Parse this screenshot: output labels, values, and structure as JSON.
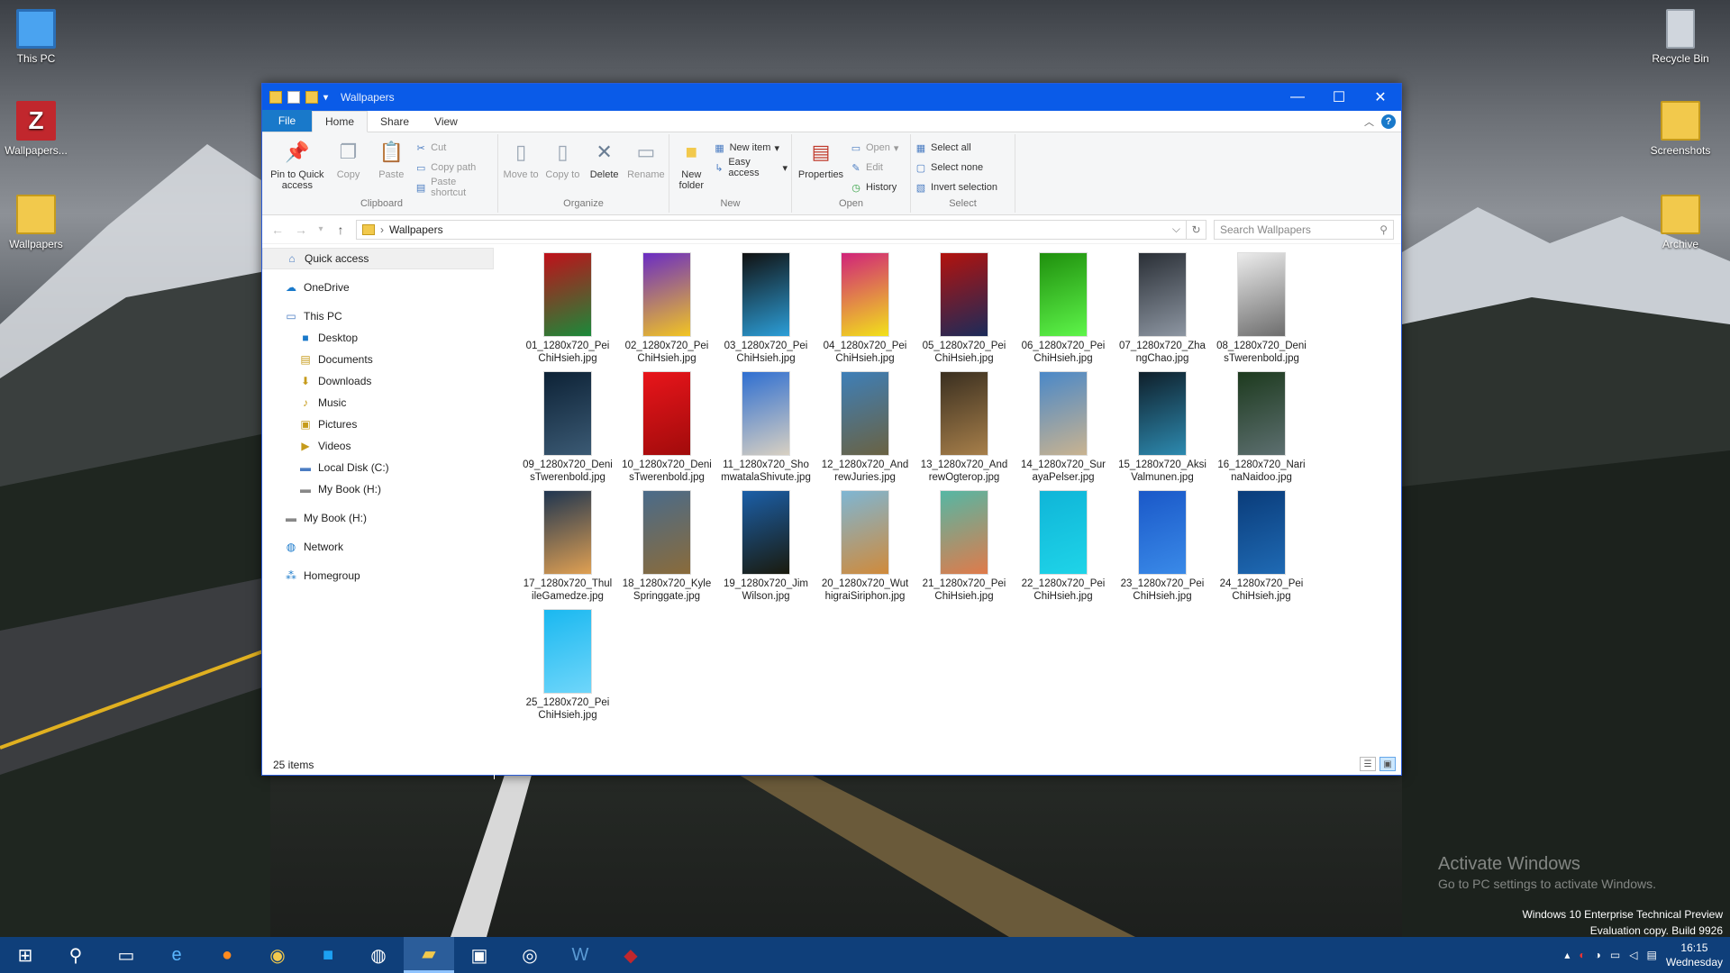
{
  "desktop": {
    "icons_left": [
      {
        "label": "This PC",
        "icon": "pc-icon",
        "color": "#4aa3f0"
      },
      {
        "label": "Wallpapers...",
        "icon": "zotero-icon",
        "color": "#c1272d"
      },
      {
        "label": "Wallpapers",
        "icon": "folder-icon",
        "color": "#f2c94c"
      }
    ],
    "icons_right": [
      {
        "label": "Recycle Bin",
        "icon": "recycle-bin-icon",
        "color": "#d0d6dd"
      },
      {
        "label": "Screenshots",
        "icon": "folder-icon",
        "color": "#f2c94c"
      },
      {
        "label": "Archive",
        "icon": "folder-icon",
        "color": "#f2c94c"
      }
    ],
    "watermark": {
      "line1": "Activate Windows",
      "line2": "Go to PC settings to activate Windows."
    },
    "build": {
      "line1": "Windows 10 Enterprise Technical Preview",
      "line2": "Evaluation copy. Build 9926"
    }
  },
  "window": {
    "title": "Wallpapers",
    "tabs": [
      "File",
      "Home",
      "Share",
      "View"
    ],
    "active_tab": "Home",
    "ribbon": {
      "clipboard": {
        "label": "Clipboard",
        "pin": "Pin to Quick access",
        "copy": "Copy",
        "paste": "Paste",
        "cut": "Cut",
        "copy_path": "Copy path",
        "paste_shortcut": "Paste shortcut"
      },
      "organize": {
        "label": "Organize",
        "move_to": "Move to",
        "copy_to": "Copy to",
        "delete": "Delete",
        "rename": "Rename"
      },
      "new": {
        "label": "New",
        "new_folder": "New folder",
        "new_item": "New item",
        "easy_access": "Easy access"
      },
      "open": {
        "label": "Open",
        "properties": "Properties",
        "open": "Open",
        "edit": "Edit",
        "history": "History"
      },
      "select": {
        "label": "Select",
        "select_all": "Select all",
        "select_none": "Select none",
        "invert": "Invert selection"
      }
    },
    "address": {
      "path": "Wallpapers",
      "search_placeholder": "Search Wallpapers"
    },
    "nav": {
      "quick_access": "Quick access",
      "onedrive": "OneDrive",
      "this_pc": "This PC",
      "this_pc_children": [
        "Desktop",
        "Documents",
        "Downloads",
        "Music",
        "Pictures",
        "Videos",
        "Local Disk (C:)",
        "My Book (H:)"
      ],
      "my_book": "My Book (H:)",
      "network": "Network",
      "homegroup": "Homegroup"
    },
    "files": [
      {
        "name": "01_1280x720_PeiChiHsieh.jpg",
        "c1": "#c0101a",
        "c2": "#1a8a3a"
      },
      {
        "name": "02_1280x720_PeiChiHsieh.jpg",
        "c1": "#6a2cc4",
        "c2": "#f2c522"
      },
      {
        "name": "03_1280x720_PeiChiHsieh.jpg",
        "c1": "#111111",
        "c2": "#2c9ed8"
      },
      {
        "name": "04_1280x720_PeiChiHsieh.jpg",
        "c1": "#d0237a",
        "c2": "#f2e21a"
      },
      {
        "name": "05_1280x720_PeiChiHsieh.jpg",
        "c1": "#b3120d",
        "c2": "#1b2b5a"
      },
      {
        "name": "06_1280x720_PeiChiHsieh.jpg",
        "c1": "#1f8f0d",
        "c2": "#5ef54a"
      },
      {
        "name": "07_1280x720_ZhangChao.jpg",
        "c1": "#2a2f36",
        "c2": "#8d96a2"
      },
      {
        "name": "08_1280x720_DenisTwerenbold.jpg",
        "c1": "#ececec",
        "c2": "#6d6d6d"
      },
      {
        "name": "09_1280x720_DenisTwerenbold.jpg",
        "c1": "#0d2236",
        "c2": "#3b5a74"
      },
      {
        "name": "10_1280x720_DenisTwerenbold.jpg",
        "c1": "#e8151b",
        "c2": "#a10b0b"
      },
      {
        "name": "11_1280x720_ShomwatalaShivute.jpg",
        "c1": "#2f6fd1",
        "c2": "#d8d0c2"
      },
      {
        "name": "12_1280x720_AndrewJuries.jpg",
        "c1": "#3e7fb8",
        "c2": "#6a6242"
      },
      {
        "name": "13_1280x720_AndrewOgterop.jpg",
        "c1": "#3a2f20",
        "c2": "#a77f4a"
      },
      {
        "name": "14_1280x720_SurayaPelser.jpg",
        "c1": "#4a88c8",
        "c2": "#c9b390"
      },
      {
        "name": "15_1280x720_AksiValmunen.jpg",
        "c1": "#0f1f2a",
        "c2": "#2d8ab0"
      },
      {
        "name": "16_1280x720_NarinaNaidoo.jpg",
        "c1": "#1d3a1e",
        "c2": "#5d6f70"
      },
      {
        "name": "17_1280x720_ThulileGamedze.jpg",
        "c1": "#1f3550",
        "c2": "#e0a052"
      },
      {
        "name": "18_1280x720_KyleSpringgate.jpg",
        "c1": "#4a6b8a",
        "c2": "#8a6b3a"
      },
      {
        "name": "19_1280x720_JimWilson.jpg",
        "c1": "#1b5fa8",
        "c2": "#1a1a0d"
      },
      {
        "name": "20_1280x720_WuthigraiSiriphon.jpg",
        "c1": "#7eb6d4",
        "c2": "#d08a3a"
      },
      {
        "name": "21_1280x720_PeiChiHsieh.jpg",
        "c1": "#55b7a4",
        "c2": "#e07a4a"
      },
      {
        "name": "22_1280x720_PeiChiHsieh.jpg",
        "c1": "#0fb5d8",
        "c2": "#1fd4e8"
      },
      {
        "name": "23_1280x720_PeiChiHsieh.jpg",
        "c1": "#1a58c8",
        "c2": "#3a8ae8"
      },
      {
        "name": "24_1280x720_PeiChiHsieh.jpg",
        "c1": "#0a3c7a",
        "c2": "#1f6ab4"
      },
      {
        "name": "25_1280x720_PeiChiHsieh.jpg",
        "c1": "#1ab8f0",
        "c2": "#6fd6fa"
      }
    ],
    "status": "25 items"
  },
  "taskbar": {
    "apps": [
      "start-icon",
      "search-icon",
      "task-view-icon",
      "internet-explorer-icon",
      "firefox-icon",
      "chrome-icon",
      "twitter-icon",
      "network-app-icon",
      "file-explorer-icon",
      "store-icon",
      "steam-icon",
      "word-icon",
      "remote-icon"
    ],
    "time": "16:15",
    "day": "Wednesday"
  },
  "colors": {
    "accent": "#0a5be8",
    "taskbar": "#0f3f7a"
  }
}
